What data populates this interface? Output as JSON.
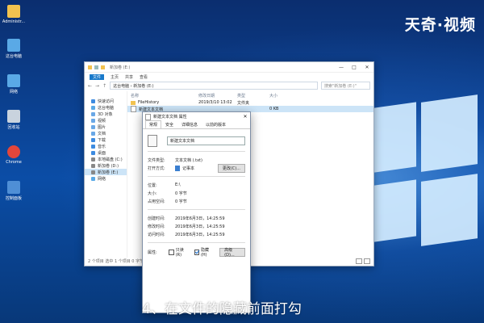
{
  "brand": "天奇·视频",
  "desktop_icons": [
    {
      "label": "Administr...",
      "icon": "user-folder-icon",
      "color": "#f2c24f"
    },
    {
      "label": "这台电脑",
      "icon": "this-pc-icon",
      "color": "#5aa9e6"
    },
    {
      "label": "网络",
      "icon": "network-icon",
      "color": "#5aa9e6"
    },
    {
      "label": "回收站",
      "icon": "recycle-bin-icon",
      "color": "#c9d3de"
    },
    {
      "label": "Chrome",
      "icon": "chrome-icon",
      "color": "#e2463b"
    },
    {
      "label": "控制面板",
      "icon": "control-panel-icon",
      "color": "#4f8fd6"
    }
  ],
  "explorer": {
    "title": "新加卷 (E:)",
    "menu": [
      "文件",
      "主页",
      "共享",
      "查看"
    ],
    "path": "这台电脑 › 新加卷 (E:)",
    "search_placeholder": "搜索\"新加卷 (E:)\"",
    "columns": {
      "name": "名称",
      "date": "修改日期",
      "type": "类型",
      "size": "大小"
    },
    "sidebar": [
      {
        "label": "快速访问",
        "color": "#3d8be0"
      },
      {
        "label": "这台电脑",
        "color": "#5aa9e6"
      },
      {
        "label": "3D 对象",
        "color": "#6aa8e6"
      },
      {
        "label": "视频",
        "color": "#6aa8e6"
      },
      {
        "label": "图片",
        "color": "#6aa8e6"
      },
      {
        "label": "文档",
        "color": "#6aa8e6"
      },
      {
        "label": "下载",
        "color": "#3d8be0"
      },
      {
        "label": "音乐",
        "color": "#3d8be0"
      },
      {
        "label": "桌面",
        "color": "#3d8be0"
      },
      {
        "label": "本地磁盘 (C:)",
        "color": "#888888"
      },
      {
        "label": "新加卷 (D:)",
        "color": "#888888"
      },
      {
        "label": "新加卷 (E:)",
        "color": "#888888"
      },
      {
        "label": "网络",
        "color": "#5aa9e6"
      }
    ],
    "rows": [
      {
        "name": "FileHistory",
        "date": "2019/3/10 13:02",
        "type": "文件夹",
        "size": ""
      },
      {
        "name": "新建文本文档",
        "date": "",
        "type": "",
        "size": "0 KB"
      }
    ],
    "status": "2 个项目   选中 1 个项目 0 字节"
  },
  "dialog": {
    "title": "新建文本文档 属性",
    "tabs": [
      "常规",
      "安全",
      "详细信息",
      "以前的版本"
    ],
    "filename": "新建文本文档",
    "file_type_label": "文件类型:",
    "file_type_value": "文本文档 (.txt)",
    "open_with_label": "打开方式:",
    "open_with_value": "记事本",
    "change_button": "更改(C)...",
    "location_label": "位置:",
    "location_value": "E:\\",
    "size_label": "大小:",
    "size_value": "0 字节",
    "disk_size_label": "占用空间:",
    "disk_size_value": "0 字节",
    "created_label": "创建时间:",
    "created_value": "2019年6月3日，14:25:59",
    "modified_label": "修改时间:",
    "modified_value": "2019年6月3日，14:25:59",
    "accessed_label": "访问时间:",
    "accessed_value": "2019年6月3日，14:25:59",
    "attributes_label": "属性:",
    "readonly_label": "只读(R)",
    "hidden_label": "隐藏(H)",
    "advanced_button": "高级(D)..."
  },
  "caption": "4、在文件的隐藏前面打勾"
}
